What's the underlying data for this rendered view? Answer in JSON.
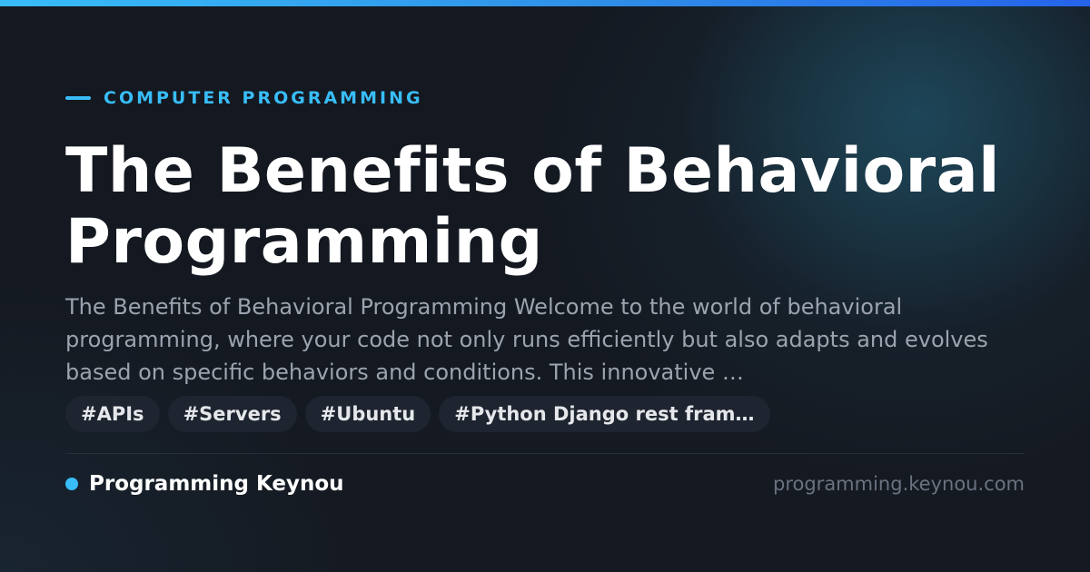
{
  "category": "COMPUTER PROGRAMMING",
  "title": "The Benefits of Behavioral Programming",
  "excerpt": "The Benefits of Behavioral Programming Welcome to the world of behavioral programming, where your code not only runs efficiently but also adapts and evolves based on specific behaviors and conditions. This innovative …",
  "tags": [
    "#APIs",
    "#Servers",
    "#Ubuntu",
    "#Python Django rest fram…"
  ],
  "brand": {
    "name": "Programming Keynou",
    "domain": "programming.keynou.com"
  },
  "colors": {
    "accent": "#38bdf8",
    "background": "#14181f",
    "tag_background": "#1e2530",
    "excerpt_text": "#9ca3af",
    "domain_text": "#6b7280"
  }
}
